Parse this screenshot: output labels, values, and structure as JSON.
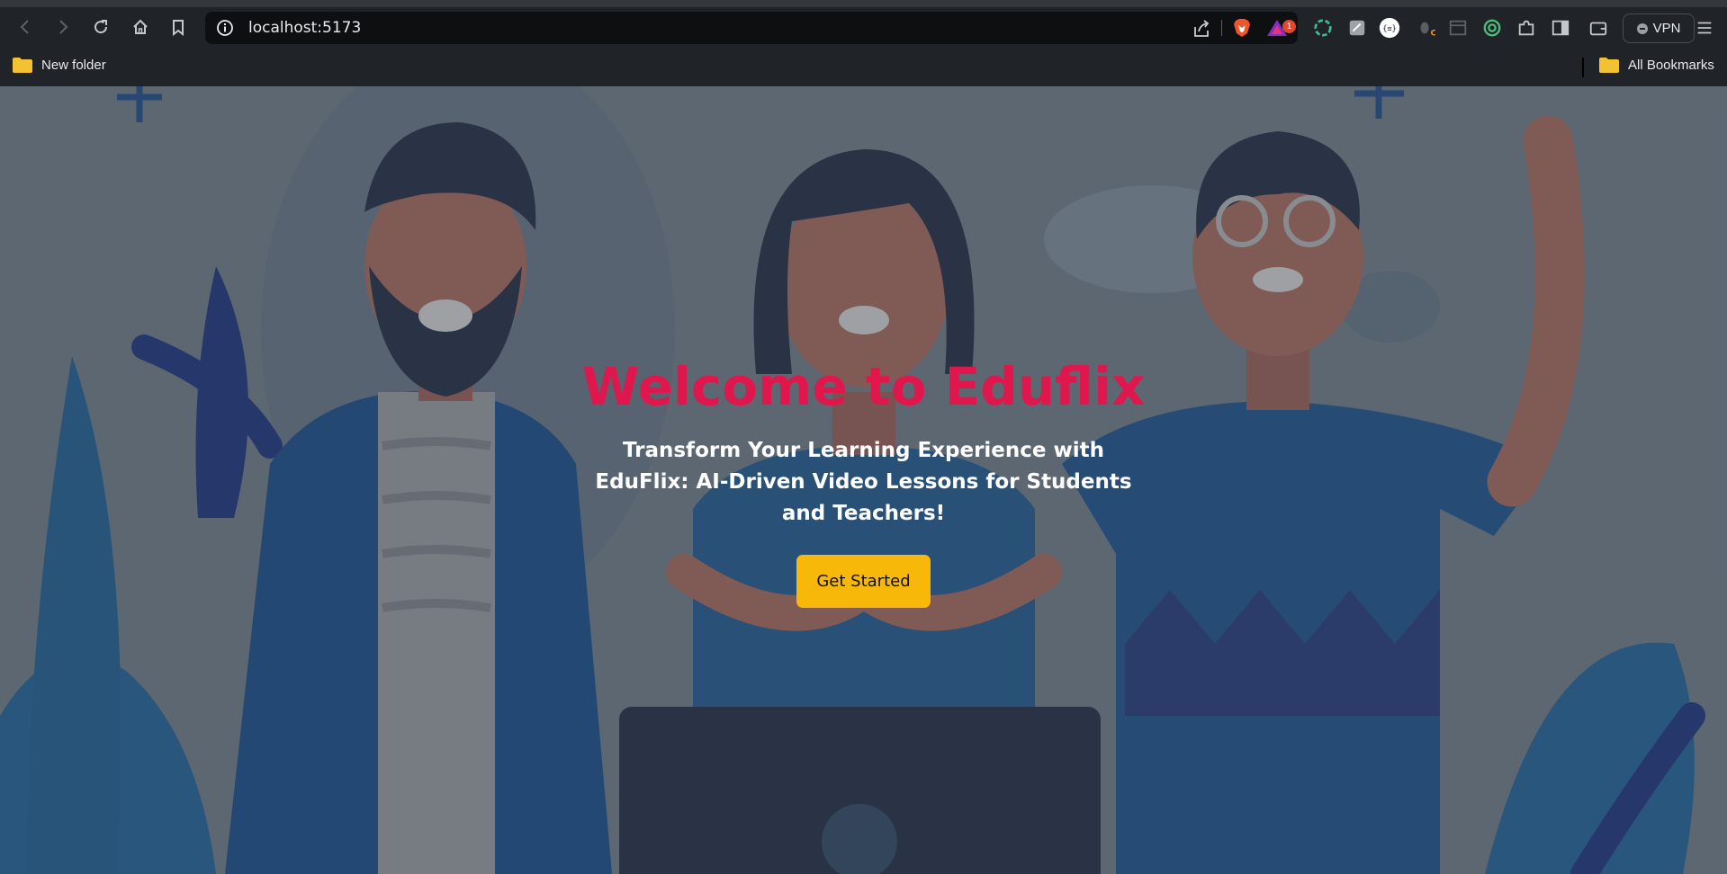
{
  "browser": {
    "url": "localhost:5173",
    "alert_badge_count": "1",
    "vpn_label": "VPN",
    "nav_icons": [
      "back-arrow-icon",
      "forward-arrow-icon",
      "reload-icon",
      "home-icon",
      "bookmark-icon"
    ],
    "extension_icons": [
      "chatgpt-icon",
      "notes-icon",
      "json-formatter-icon",
      "bug-icon",
      "wallet-icon",
      "circle-icon",
      "puzzle-icon",
      "sidebar-icon",
      "brave-wallet-icon"
    ]
  },
  "bookmarks": {
    "left_folder": "New folder",
    "right_folder": "All Bookmarks"
  },
  "hero": {
    "title": "Welcome to Eduflix",
    "subtitle": "Transform Your Learning Experience with EduFlix: AI-Driven Video Lessons for Students and Teachers!",
    "cta_label": "Get Started"
  },
  "colors": {
    "title": "#e0174d",
    "cta": "#f8b80a",
    "illustration_primary": "#1f5fa0",
    "illustration_dark": "#2b3a55"
  }
}
